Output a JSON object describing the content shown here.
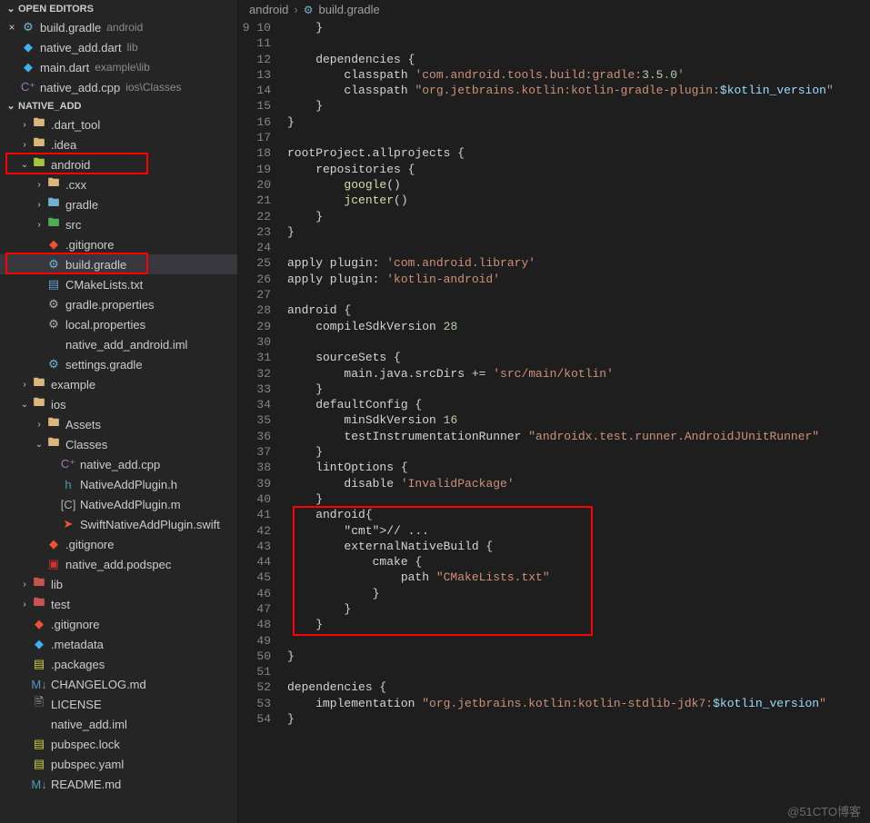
{
  "sections": {
    "openEditors": "OPEN EDITORS",
    "project": "NATIVE_ADD"
  },
  "openEditors": [
    {
      "name": "build.gradle",
      "hint": "android",
      "icon": "gradle-icon",
      "active": true
    },
    {
      "name": "native_add.dart",
      "hint": "lib",
      "icon": "dart-icon"
    },
    {
      "name": "main.dart",
      "hint": "example\\lib",
      "icon": "dart-icon"
    },
    {
      "name": "native_add.cpp",
      "hint": "ios\\Classes",
      "icon": "cpp-icon"
    }
  ],
  "tree": [
    {
      "d": 1,
      "n": ".dart_tool",
      "t": "folder-closed",
      "icon": "folder-icon"
    },
    {
      "d": 1,
      "n": ".idea",
      "t": "folder-closed",
      "icon": "folder-icon"
    },
    {
      "d": 1,
      "n": "android",
      "t": "folder-open",
      "icon": "android-folder-icon",
      "hl": true
    },
    {
      "d": 2,
      "n": ".cxx",
      "t": "folder-closed",
      "icon": "folder-icon"
    },
    {
      "d": 2,
      "n": "gradle",
      "t": "folder-closed",
      "icon": "gradle-folder-icon"
    },
    {
      "d": 2,
      "n": "src",
      "t": "folder-closed",
      "icon": "src-folder-icon"
    },
    {
      "d": 2,
      "n": ".gitignore",
      "t": "file",
      "icon": "git-icon"
    },
    {
      "d": 2,
      "n": "build.gradle",
      "t": "file",
      "icon": "gradle-icon",
      "sel": true,
      "hl": true
    },
    {
      "d": 2,
      "n": "CMakeLists.txt",
      "t": "file",
      "icon": "cmake-icon"
    },
    {
      "d": 2,
      "n": "gradle.properties",
      "t": "file",
      "icon": "gear-icon"
    },
    {
      "d": 2,
      "n": "local.properties",
      "t": "file",
      "icon": "gear-icon"
    },
    {
      "d": 2,
      "n": "native_add_android.iml",
      "t": "file",
      "icon": "xml-icon"
    },
    {
      "d": 2,
      "n": "settings.gradle",
      "t": "file",
      "icon": "gradle-icon"
    },
    {
      "d": 1,
      "n": "example",
      "t": "folder-closed",
      "icon": "folder-icon"
    },
    {
      "d": 1,
      "n": "ios",
      "t": "folder-open",
      "icon": "folder-icon"
    },
    {
      "d": 2,
      "n": "Assets",
      "t": "folder-closed",
      "icon": "folder-icon"
    },
    {
      "d": 2,
      "n": "Classes",
      "t": "folder-open",
      "icon": "folder-icon"
    },
    {
      "d": 3,
      "n": "native_add.cpp",
      "t": "file",
      "icon": "cpp-icon"
    },
    {
      "d": 3,
      "n": "NativeAddPlugin.h",
      "t": "file",
      "icon": "h-icon"
    },
    {
      "d": 3,
      "n": "NativeAddPlugin.m",
      "t": "file",
      "icon": "m-icon"
    },
    {
      "d": 3,
      "n": "SwiftNativeAddPlugin.swift",
      "t": "file",
      "icon": "swift-icon"
    },
    {
      "d": 2,
      "n": ".gitignore",
      "t": "file",
      "icon": "git-icon"
    },
    {
      "d": 2,
      "n": "native_add.podspec",
      "t": "file",
      "icon": "pod-icon"
    },
    {
      "d": 1,
      "n": "lib",
      "t": "folder-closed",
      "icon": "lib-folder-icon"
    },
    {
      "d": 1,
      "n": "test",
      "t": "folder-closed",
      "icon": "test-folder-icon"
    },
    {
      "d": 1,
      "n": ".gitignore",
      "t": "file",
      "icon": "git-icon"
    },
    {
      "d": 1,
      "n": ".metadata",
      "t": "file",
      "icon": "meta-icon"
    },
    {
      "d": 1,
      "n": ".packages",
      "t": "file",
      "icon": "pkg-icon"
    },
    {
      "d": 1,
      "n": "CHANGELOG.md",
      "t": "file",
      "icon": "md-icon"
    },
    {
      "d": 1,
      "n": "LICENSE",
      "t": "file",
      "icon": "txt-icon"
    },
    {
      "d": 1,
      "n": "native_add.iml",
      "t": "file",
      "icon": "xml-icon"
    },
    {
      "d": 1,
      "n": "pubspec.lock",
      "t": "file",
      "icon": "lock-icon"
    },
    {
      "d": 1,
      "n": "pubspec.yaml",
      "t": "file",
      "icon": "yaml-icon"
    },
    {
      "d": 1,
      "n": "README.md",
      "t": "file",
      "icon": "md-icon"
    }
  ],
  "breadcrumb": {
    "segments": [
      "android",
      "build.gradle"
    ]
  },
  "code": {
    "startLine": 9,
    "endLine": 54,
    "lines": [
      "    }",
      "",
      "    dependencies {",
      "        classpath 'com.android.tools.build:gradle:3.5.0'",
      "        classpath \"org.jetbrains.kotlin:kotlin-gradle-plugin:$kotlin_version\"",
      "    }",
      "}",
      "",
      "rootProject.allprojects {",
      "    repositories {",
      "        google()",
      "        jcenter()",
      "    }",
      "}",
      "",
      "apply plugin: 'com.android.library'",
      "apply plugin: 'kotlin-android'",
      "",
      "android {",
      "    compileSdkVersion 28",
      "",
      "    sourceSets {",
      "        main.java.srcDirs += 'src/main/kotlin'",
      "    }",
      "    defaultConfig {",
      "        minSdkVersion 16",
      "        testInstrumentationRunner \"androidx.test.runner.AndroidJUnitRunner\"",
      "    }",
      "    lintOptions {",
      "        disable 'InvalidPackage'",
      "    }",
      "    android{",
      "        // ...",
      "        externalNativeBuild {",
      "            cmake {",
      "                path \"CMakeLists.txt\"",
      "            }",
      "        }",
      "    }",
      "",
      "}",
      "",
      "dependencies {",
      "    implementation \"org.jetbrains.kotlin:kotlin-stdlib-jdk7:$kotlin_version\"",
      "}",
      ""
    ],
    "highlightBlock": {
      "fromLine": 40,
      "toLine": 47
    }
  },
  "watermark": "@51CTO博客"
}
